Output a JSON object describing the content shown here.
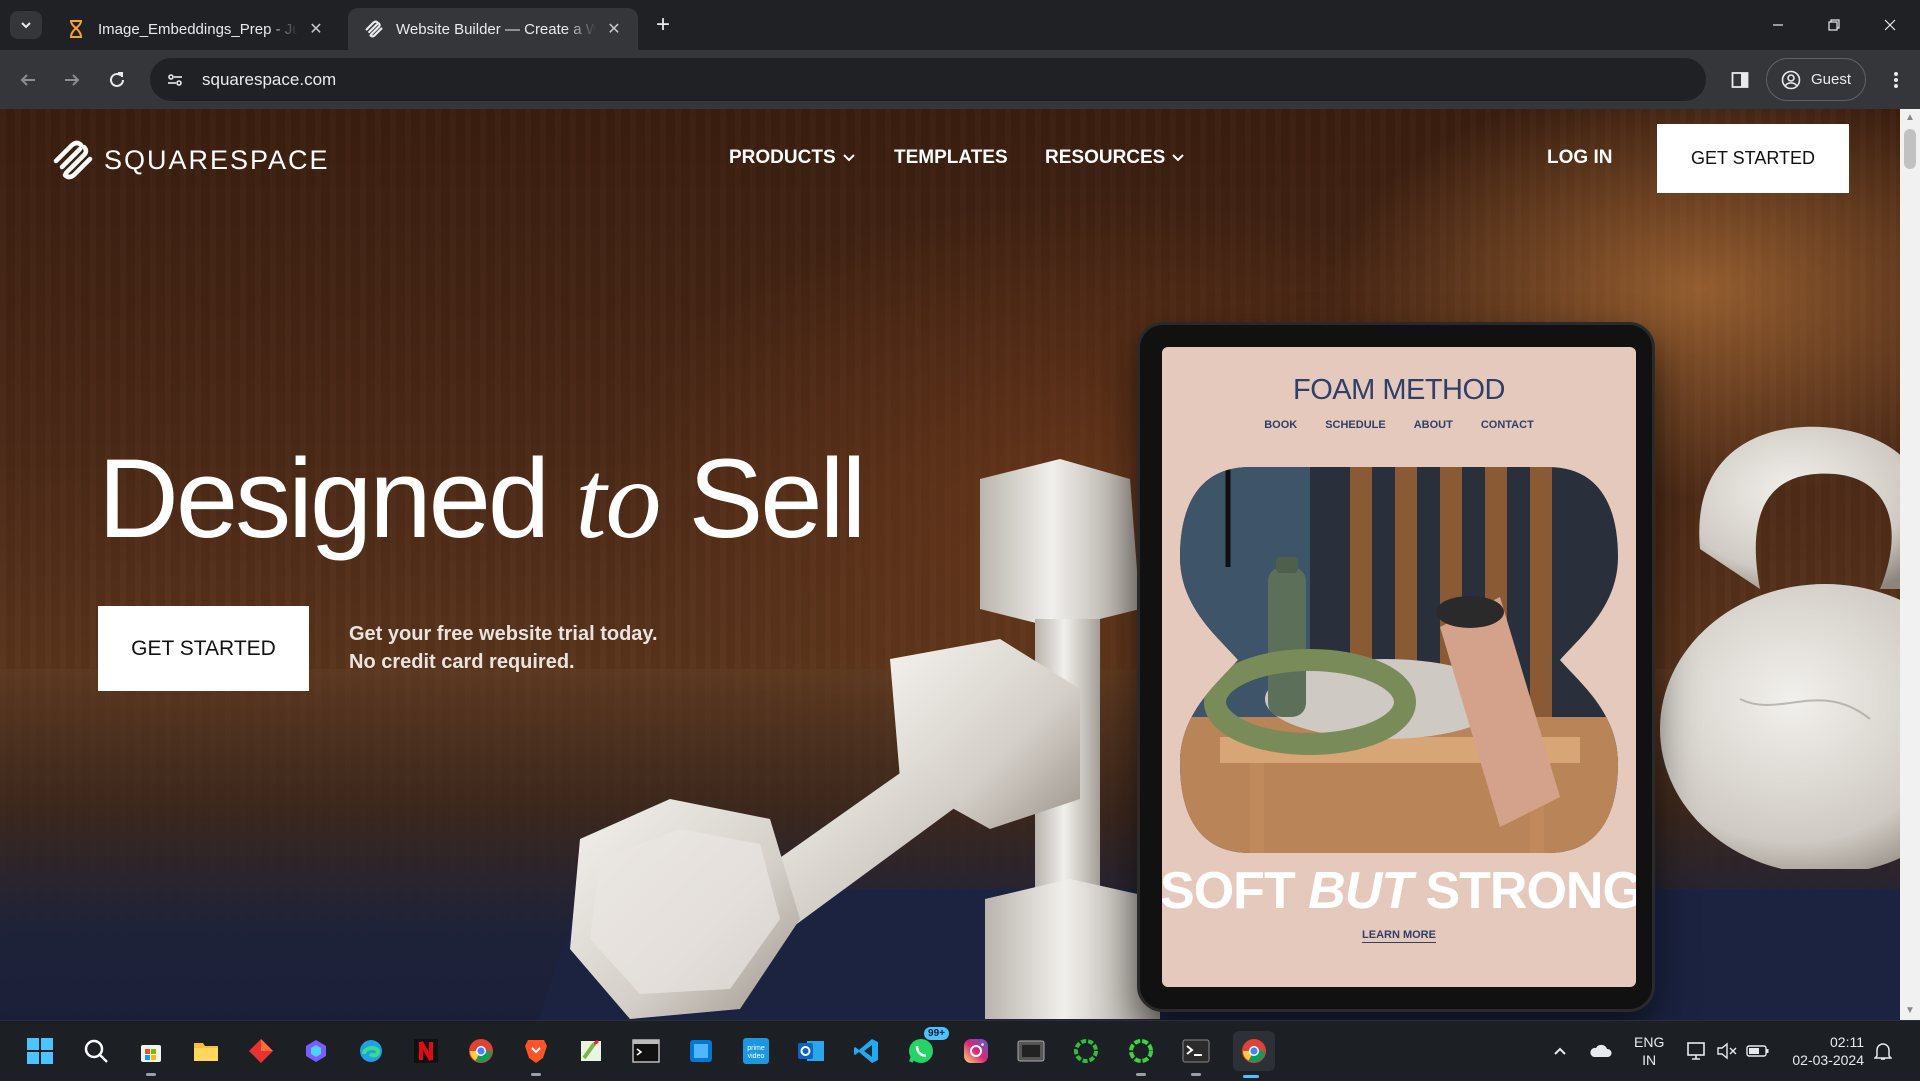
{
  "browser": {
    "tabs": [
      {
        "title": "Image_Embeddings_Prep - Jupyter",
        "active": false
      },
      {
        "title": "Website Builder — Create a Website",
        "active": true
      }
    ],
    "new_tab": "+",
    "url": "squarespace.com",
    "profile": "Guest"
  },
  "site": {
    "logo": "SQUARESPACE",
    "nav": {
      "products": "PRODUCTS",
      "templates": "TEMPLATES",
      "resources": "RESOURCES",
      "login": "LOG IN",
      "get_started": "GET STARTED"
    },
    "hero": {
      "headline_a": "Designed ",
      "headline_b": "to",
      "headline_c": " Sell",
      "cta": "GET STARTED",
      "sub_line1": "Get your free website trial today.",
      "sub_line2": "No credit card required."
    },
    "tablet": {
      "title": "FOAM METHOD",
      "nav": [
        "BOOK",
        "SCHEDULE",
        "ABOUT",
        "CONTACT"
      ],
      "tag_a": "SOFT ",
      "tag_b": "BUT",
      "tag_c": " STRONG",
      "learn_more": "LEARN MORE"
    }
  },
  "taskbar": {
    "apps": [
      "windows-start",
      "search",
      "microsoft-store",
      "file-explorer",
      "red-app",
      "copilot",
      "edge",
      "netflix",
      "chrome",
      "brave",
      "notepad-plus",
      "terminal-dark",
      "windows-app",
      "prime-video",
      "outlook",
      "vscode",
      "whatsapp",
      "instagram",
      "media-app",
      "green-ring-1",
      "green-ring-2",
      "command-prompt",
      "chrome-active"
    ],
    "whatsapp_badge": "99+",
    "language_top": "ENG",
    "language_bottom": "IN",
    "time": "02:11",
    "date": "02-03-2024"
  },
  "colors": {
    "chrome_dark": "#202124",
    "chrome_mid": "#35363a",
    "foam_blue": "#2e3f68",
    "tablet_pink": "#e6c9bd",
    "accent": "#4cc2ff"
  }
}
